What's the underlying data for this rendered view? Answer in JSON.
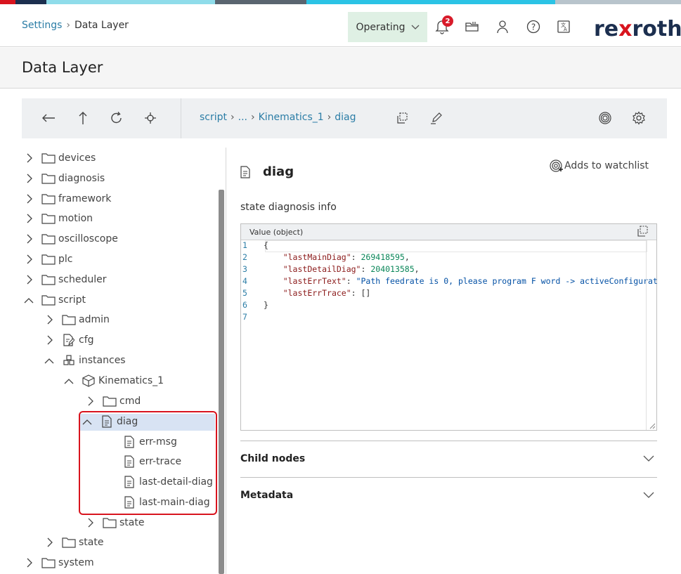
{
  "colors": {
    "accent_link": "#2b7da6",
    "operating_bg": "#dff0e4",
    "badge": "#d81b2a",
    "brand_dark": "#1c2f4f",
    "brand_red": "#d8141e",
    "selection": "#d8e3f3"
  },
  "header": {
    "breadcrumb_root": "Settings",
    "breadcrumb_current": "Data Layer",
    "operating_label": "Operating",
    "notification_count": "2",
    "logo_text_a": "re",
    "logo_text_b": "x",
    "logo_text_c": "roth",
    "icons": [
      "bell-icon",
      "folder-open-icon",
      "user-icon",
      "help-icon",
      "language-icon"
    ]
  },
  "page": {
    "title": "Data Layer"
  },
  "toolbar": {
    "icons": [
      "back-arrow-icon",
      "up-arrow-icon",
      "refresh-icon",
      "target-icon",
      "copy-icon",
      "edit-icon",
      "watch-icon",
      "settings-gear-icon"
    ],
    "path": {
      "root": "script",
      "ellipsis": "...",
      "parent": "Kinematics_1",
      "current": "diag"
    }
  },
  "tree": {
    "items": [
      {
        "label": "devices",
        "expanded": false,
        "icon": "folder-icon"
      },
      {
        "label": "diagnosis",
        "expanded": false,
        "icon": "folder-icon"
      },
      {
        "label": "framework",
        "expanded": false,
        "icon": "folder-icon"
      },
      {
        "label": "motion",
        "expanded": false,
        "icon": "folder-icon"
      },
      {
        "label": "oscilloscope",
        "expanded": false,
        "icon": "folder-icon"
      },
      {
        "label": "plc",
        "expanded": false,
        "icon": "folder-icon"
      },
      {
        "label": "scheduler",
        "expanded": false,
        "icon": "folder-icon"
      },
      {
        "label": "script",
        "expanded": true,
        "icon": "folder-icon"
      },
      {
        "label": "admin",
        "expanded": false,
        "icon": "folder-icon"
      },
      {
        "label": "cfg",
        "expanded": false,
        "icon": "config-file-icon"
      },
      {
        "label": "instances",
        "expanded": true,
        "icon": "instances-icon"
      },
      {
        "label": "Kinematics_1",
        "expanded": true,
        "icon": "cube-icon"
      },
      {
        "label": "cmd",
        "expanded": false,
        "icon": "folder-icon"
      },
      {
        "label": "diag",
        "expanded": true,
        "icon": "document-icon",
        "selected": true
      },
      {
        "label": "err-msg",
        "icon": "document-icon"
      },
      {
        "label": "err-trace",
        "icon": "document-icon"
      },
      {
        "label": "last-detail-diag",
        "icon": "document-icon"
      },
      {
        "label": "last-main-diag",
        "icon": "document-icon"
      },
      {
        "label": "state",
        "expanded": false,
        "icon": "folder-icon"
      },
      {
        "label": "state",
        "expanded": false,
        "icon": "folder-icon"
      },
      {
        "label": "system",
        "expanded": false,
        "icon": "folder-icon"
      }
    ]
  },
  "detail": {
    "node_name": "diag",
    "watch_label": "Adds to watchlist",
    "description": "state diagnosis info",
    "value_header": "Value (object)",
    "code": {
      "l1": "{",
      "k2": "\"lastMainDiag\"",
      "v2": "269418595",
      "k3": "\"lastDetailDiag\"",
      "v3": "204013585",
      "k4": "\"lastErrText\"",
      "v4": "\"Path feedrate is 0, please program F word -> activeConfigurat",
      "k5": "\"lastErrTrace\"",
      "v5": "[]",
      "l6": "}",
      "line_numbers": [
        "1",
        "2",
        "3",
        "4",
        "5",
        "6",
        "7"
      ]
    },
    "sections": {
      "child_nodes": "Child nodes",
      "metadata": "Metadata"
    }
  }
}
